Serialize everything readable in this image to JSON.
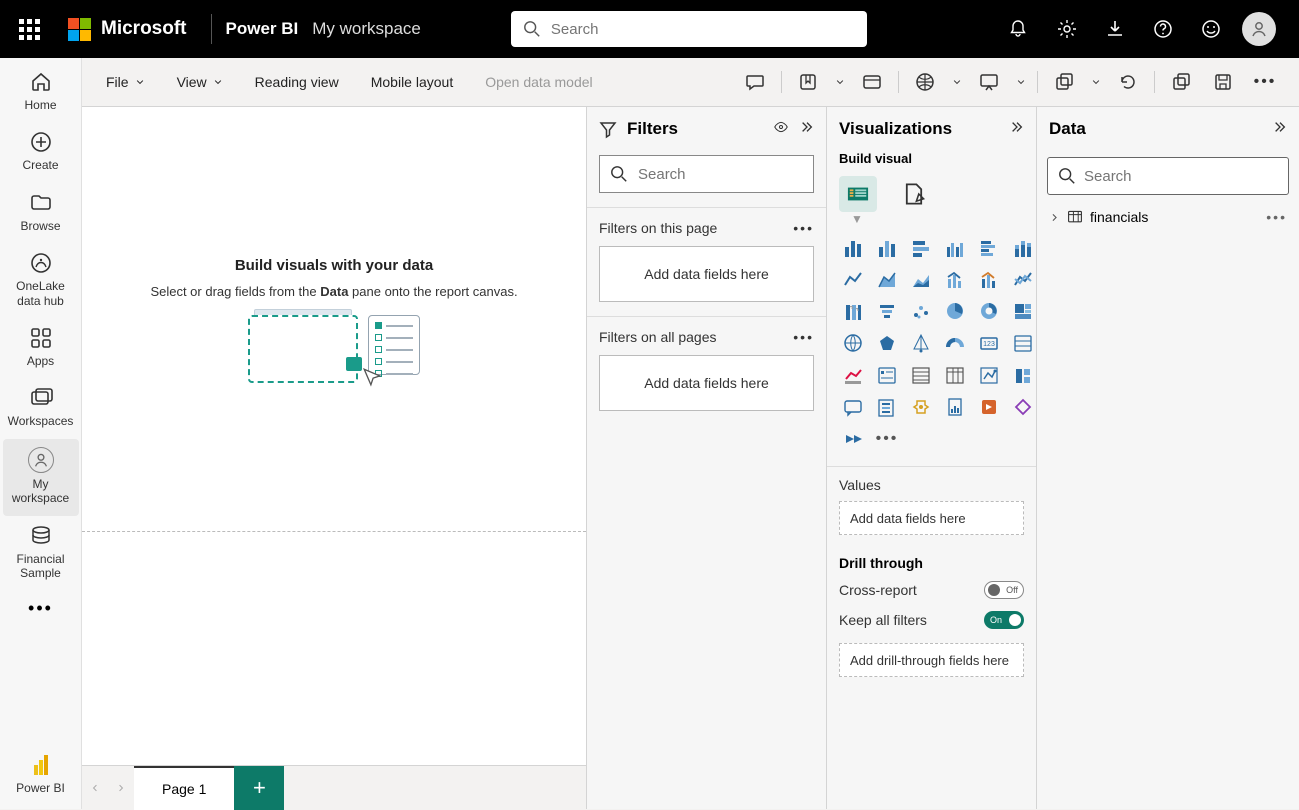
{
  "topbar": {
    "ms_label": "Microsoft",
    "product_label": "Power BI",
    "workspace_label": "My workspace",
    "search_placeholder": "Search"
  },
  "leftnav": {
    "home": "Home",
    "create": "Create",
    "browse": "Browse",
    "onelake": "OneLake data hub",
    "apps": "Apps",
    "workspaces": "Workspaces",
    "myworkspace": "My workspace",
    "financial_sample": "Financial Sample",
    "powerbi": "Power BI"
  },
  "ribbon": {
    "file": "File",
    "view": "View",
    "reading_view": "Reading view",
    "mobile_layout": "Mobile layout",
    "open_data_model": "Open data model"
  },
  "canvas": {
    "title": "Build visuals with your data",
    "subtitle_pre": "Select or drag fields from the ",
    "subtitle_bold": "Data",
    "subtitle_post": " pane onto the report canvas."
  },
  "pagetabs": {
    "page1": "Page 1"
  },
  "filters": {
    "title": "Filters",
    "search_placeholder": "Search",
    "on_this_page": "Filters on this page",
    "on_all_pages": "Filters on all pages",
    "add_fields": "Add data fields here"
  },
  "viz": {
    "title": "Visualizations",
    "build_visual": "Build visual",
    "values": "Values",
    "add_fields": "Add data fields here",
    "drill_through": "Drill through",
    "cross_report": "Cross-report",
    "keep_all_filters": "Keep all filters",
    "add_drill": "Add drill-through fields here"
  },
  "data": {
    "title": "Data",
    "search_placeholder": "Search",
    "table1": "financials"
  }
}
